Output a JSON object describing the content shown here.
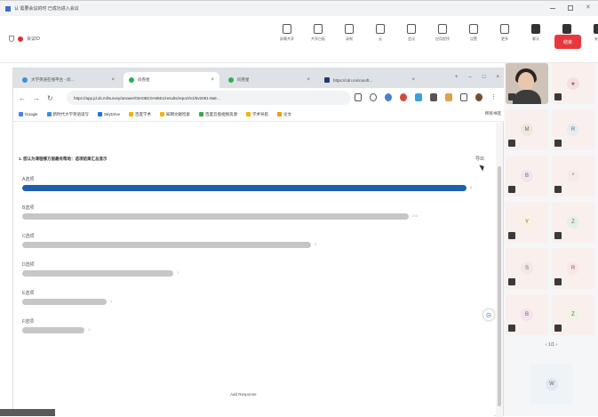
{
  "window": {
    "title": "认 需要会议的时 已成功进入会议"
  },
  "meeting": {
    "id_label": "会议ID",
    "tools": [
      {
        "label": "屏幕共享",
        "icon": "screen-share-icon"
      },
      {
        "label": "共享白板",
        "icon": "whiteboard-icon"
      },
      {
        "label": "录制",
        "icon": "record-icon"
      },
      {
        "label": "云",
        "icon": "cloud-icon"
      },
      {
        "label": "会议",
        "icon": "meeting-icon"
      },
      {
        "label": "应用程序",
        "icon": "apps-icon"
      },
      {
        "label": "设置",
        "icon": "settings-icon"
      },
      {
        "label": "更多",
        "icon": "more-icon"
      },
      {
        "label": "聊天",
        "icon": "chat-icon"
      },
      {
        "label": "成员",
        "icon": "members-icon"
      },
      {
        "label": "安全",
        "icon": "security-icon"
      }
    ],
    "end_button": "结束"
  },
  "browser": {
    "tabs": [
      {
        "label": "大学英语在线平台 - 问…",
        "icon": "tab-favicon"
      },
      {
        "label": "问卷星",
        "icon": "tab-favicon"
      },
      {
        "label": "问卷星",
        "icon": "tab-favicon"
      },
      {
        "label": "https://cdn.microsoft…",
        "icon": "tab-favicon"
      }
    ],
    "url": "https://app.jd.xb.ml/survey/answer/03A0BC0A95E1/results/report/v1/5v2091-9a8…",
    "bookmarks": [
      "Google",
      "新时代大学英语读写",
      "SkyDrive",
      "百度学术",
      "知网文献检索",
      "百度云盘视频资源",
      "学术导航",
      "论文"
    ],
    "bookmarks_right": "所有书签"
  },
  "survey": {
    "question": "1. 您认为课程哪方面最有帮助：选项结果汇总显示",
    "corner": "导出",
    "options": [
      {
        "label": "A选项",
        "value_text": "5",
        "percent": 100
      },
      {
        "label": "B选项",
        "value_text": "2.8 ·",
        "percent": 87
      },
      {
        "label": "C选项",
        "value_text": "2",
        "percent": 65
      },
      {
        "label": "D选项",
        "value_text": "1",
        "percent": 34
      },
      {
        "label": "E选项",
        "value_text": "1",
        "percent": 19
      },
      {
        "label": "F选项",
        "value_text": "1",
        "percent": 14
      }
    ],
    "footer": "Add Response"
  },
  "participants": {
    "tiles": [
      {
        "name": "",
        "avatar_color": "#f6dede",
        "glyph": "★"
      },
      {
        "name": "",
        "avatar_color": "#efe7d7",
        "glyph": "M"
      },
      {
        "name": "",
        "avatar_color": "#e5ecf4",
        "glyph": "R"
      },
      {
        "name": "",
        "avatar_color": "#f2e5f0",
        "glyph": "B"
      },
      {
        "name": "",
        "avatar_color": "#f7e9e6",
        "glyph": "*"
      },
      {
        "name": "",
        "avatar_color": "#fbf1dc",
        "glyph": "Y"
      },
      {
        "name": "",
        "avatar_color": "#e5f0e4",
        "glyph": "Z"
      },
      {
        "name": "",
        "avatar_color": "#f2e9e4",
        "glyph": "S"
      },
      {
        "name": "",
        "avatar_color": "#fbe6e2",
        "glyph": "R"
      },
      {
        "name": "",
        "avatar_color": "#f6e2ef",
        "glyph": "B"
      },
      {
        "name": "",
        "avatar_color": "#eef4e2",
        "glyph": "Z"
      }
    ],
    "page_indicator": "‹ 1/1 ›",
    "last_glyph": "W"
  },
  "colors": {
    "lead_bar": "#1f5fae",
    "other_bar": "#c6c6c6",
    "end": "#e8383d"
  }
}
